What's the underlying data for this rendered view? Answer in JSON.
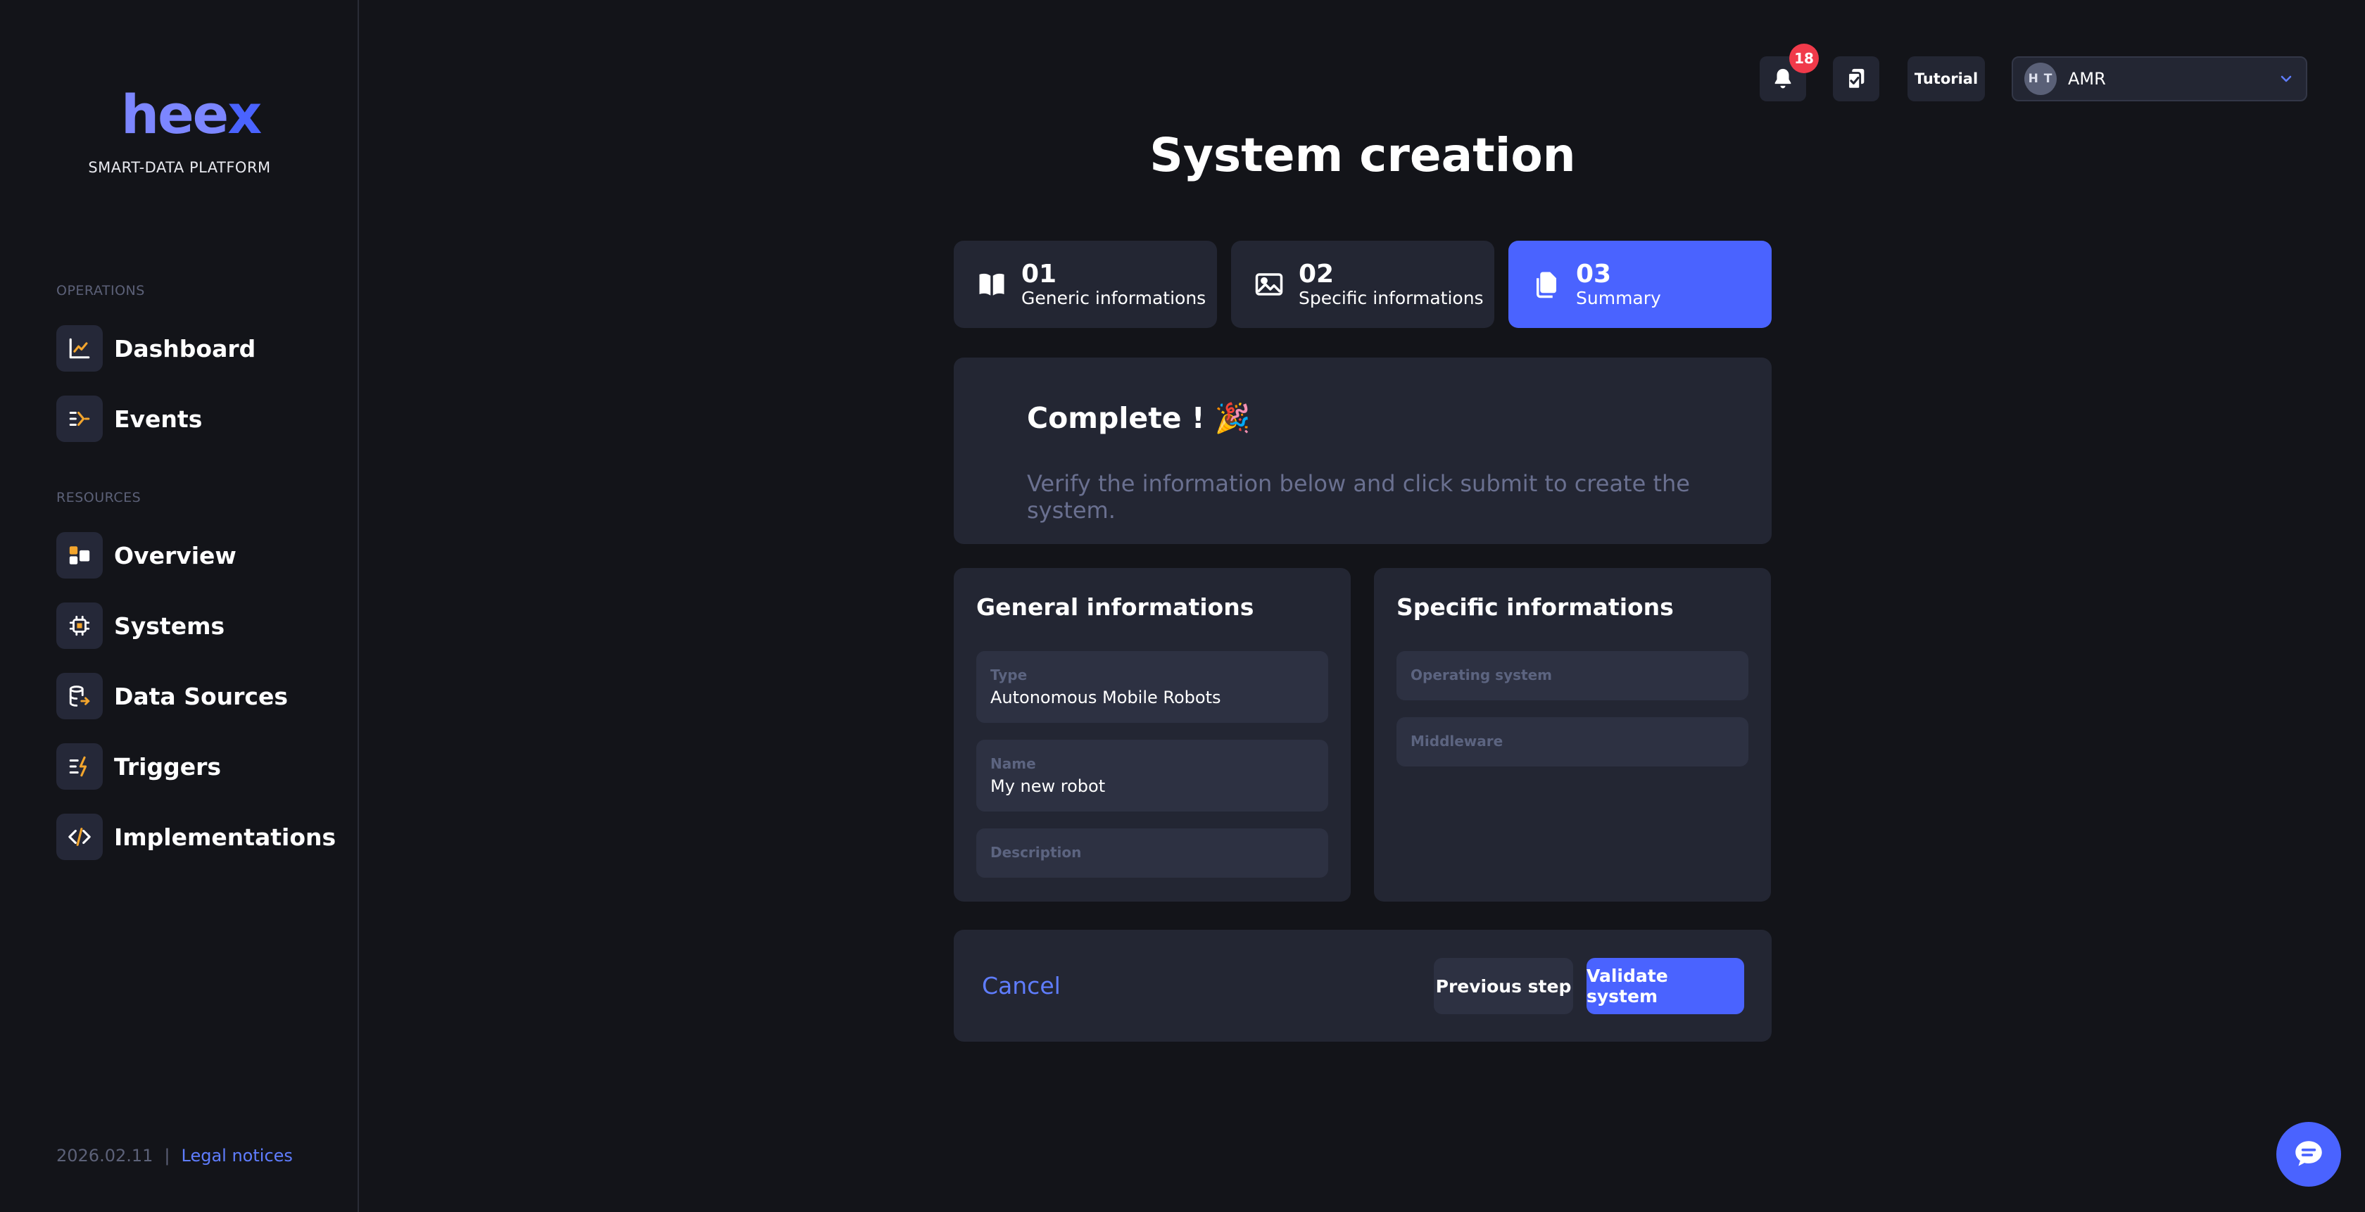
{
  "brand": {
    "logo_text_main": "hee",
    "logo_text_x": "x",
    "tagline": "SMART-DATA PLATFORM"
  },
  "sidebar": {
    "sections": [
      {
        "label": "OPERATIONS",
        "items": [
          {
            "label": "Dashboard",
            "icon": "chart-line-icon"
          },
          {
            "label": "Events",
            "icon": "events-icon"
          }
        ]
      },
      {
        "label": "RESOURCES",
        "items": [
          {
            "label": "Overview",
            "icon": "overview-icon"
          },
          {
            "label": "Systems",
            "icon": "chip-icon"
          },
          {
            "label": "Data Sources",
            "icon": "database-icon"
          },
          {
            "label": "Triggers",
            "icon": "trigger-icon"
          },
          {
            "label": "Implementations",
            "icon": "code-icon"
          }
        ]
      }
    ],
    "footer": {
      "version": "2026.02.11",
      "separator": "|",
      "legal_link": "Legal notices"
    }
  },
  "topbar": {
    "notifications_count": "18",
    "tutorial_label": "Tutorial",
    "user": {
      "initials": "H T",
      "name": "AMR"
    }
  },
  "page": {
    "title": "System creation"
  },
  "steps": [
    {
      "number": "01",
      "label": "Generic informations",
      "icon": "book-icon",
      "active": false
    },
    {
      "number": "02",
      "label": "Specific informations",
      "icon": "image-icon",
      "active": false
    },
    {
      "number": "03",
      "label": "Summary",
      "icon": "copy-icon",
      "active": true
    }
  ],
  "complete": {
    "title": "Complete ! 🎉",
    "subtitle": "Verify the information below and click submit to create the system."
  },
  "general": {
    "title": "General informations",
    "fields": [
      {
        "label": "Type",
        "value": "Autonomous Mobile Robots"
      },
      {
        "label": "Name",
        "value": "My new robot"
      },
      {
        "label": "Description",
        "value": ""
      }
    ]
  },
  "specific": {
    "title": "Specific informations",
    "fields": [
      {
        "label": "Operating system",
        "value": ""
      },
      {
        "label": "Middleware",
        "value": ""
      }
    ]
  },
  "actions": {
    "cancel_label": "Cancel",
    "previous_label": "Previous step",
    "validate_label": "Validate system"
  },
  "colors": {
    "accent": "#4a63ff",
    "background": "#131419",
    "panel": "#232633",
    "badge": "#f03a4a"
  }
}
